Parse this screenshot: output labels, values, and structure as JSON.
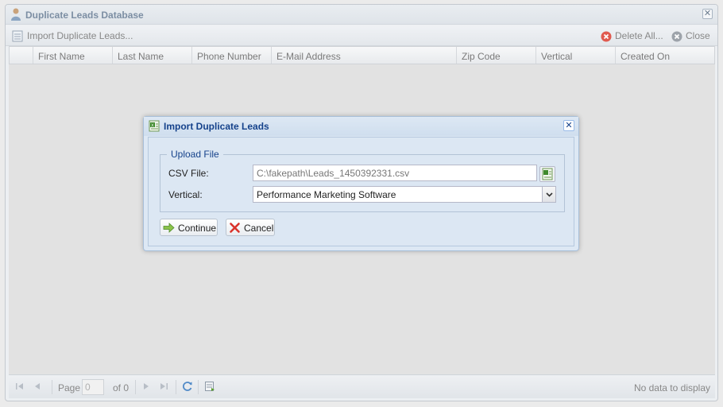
{
  "window": {
    "title": "Duplicate Leads Database",
    "close_glyph": "✕"
  },
  "toolbar": {
    "import_label": "Import Duplicate Leads...",
    "delete_all_label": "Delete All...",
    "close_label": "Close"
  },
  "grid": {
    "columns": [
      "First Name",
      "Last Name",
      "Phone Number",
      "E-Mail Address",
      "Zip Code",
      "Vertical",
      "Created On"
    ],
    "rows": []
  },
  "pager": {
    "page_label": "Page",
    "page_value": "0",
    "of_label": "of 0",
    "status": "No data to display"
  },
  "dialog": {
    "title": "Import Duplicate Leads",
    "close_glyph": "✕",
    "fieldset_legend": "Upload File",
    "csv_label": "CSV File:",
    "csv_value": "C:\\fakepath\\Leads_1450392331.csv",
    "vertical_label": "Vertical:",
    "vertical_value": "Performance Marketing Software",
    "continue_label": "Continue",
    "cancel_label": "Cancel"
  },
  "colors": {
    "dialog_title": "#15428b",
    "window_title": "#7c8ea3",
    "delete_icon": "#e05a4f",
    "continue_icon": "#5aa02c",
    "cancel_icon": "#d9332b"
  },
  "icons": {
    "window": "user-icon",
    "import": "spreadsheet-icon",
    "delete_all": "delete-icon",
    "close": "close-icon",
    "refresh": "refresh-icon",
    "export": "export-icon",
    "continue": "arrow-right-icon",
    "cancel": "cancel-x-icon"
  }
}
